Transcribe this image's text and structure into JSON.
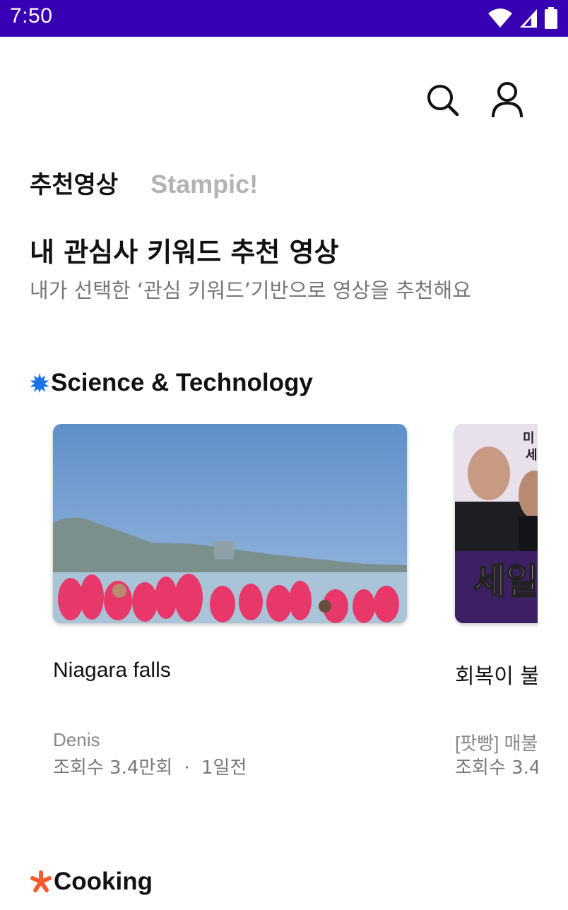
{
  "status_bar": {
    "time": "7:50",
    "icons": [
      "wifi-icon",
      "cellular-signal-icon",
      "battery-icon"
    ]
  },
  "header": {
    "actions": [
      "search-icon",
      "profile-icon"
    ]
  },
  "tabs": [
    {
      "label": "추천영상",
      "active": true
    },
    {
      "label": "Stampic!",
      "active": false
    }
  ],
  "section": {
    "title": "내 관심사 키워드 추천 영상",
    "subtitle": "내가 선택한 ‘관심 키워드’기반으로 영상을 추천해요"
  },
  "categories": [
    {
      "label": "Science & Technology",
      "icon": "starburst-icon",
      "icon_color": "#1a73e8",
      "videos": [
        {
          "title": "Niagara falls",
          "channel": "Denis",
          "views": "조회수 3.4만회",
          "separator": "·",
          "age": "1일전"
        },
        {
          "title": "회복이 불",
          "channel": "[팟빵] 매불",
          "views": "조회수 3.4"
        }
      ]
    },
    {
      "label": "Cooking",
      "icon": "asterisk-icon",
      "icon_color": "#ff5a2d"
    }
  ],
  "thumb2_text": {
    "big": "세일",
    "small1": "미",
    "small2": "세"
  },
  "colors": {
    "status_bar": "#3700b3",
    "inactive_tab": "#b3b3b3",
    "subtitle": "#777777"
  }
}
